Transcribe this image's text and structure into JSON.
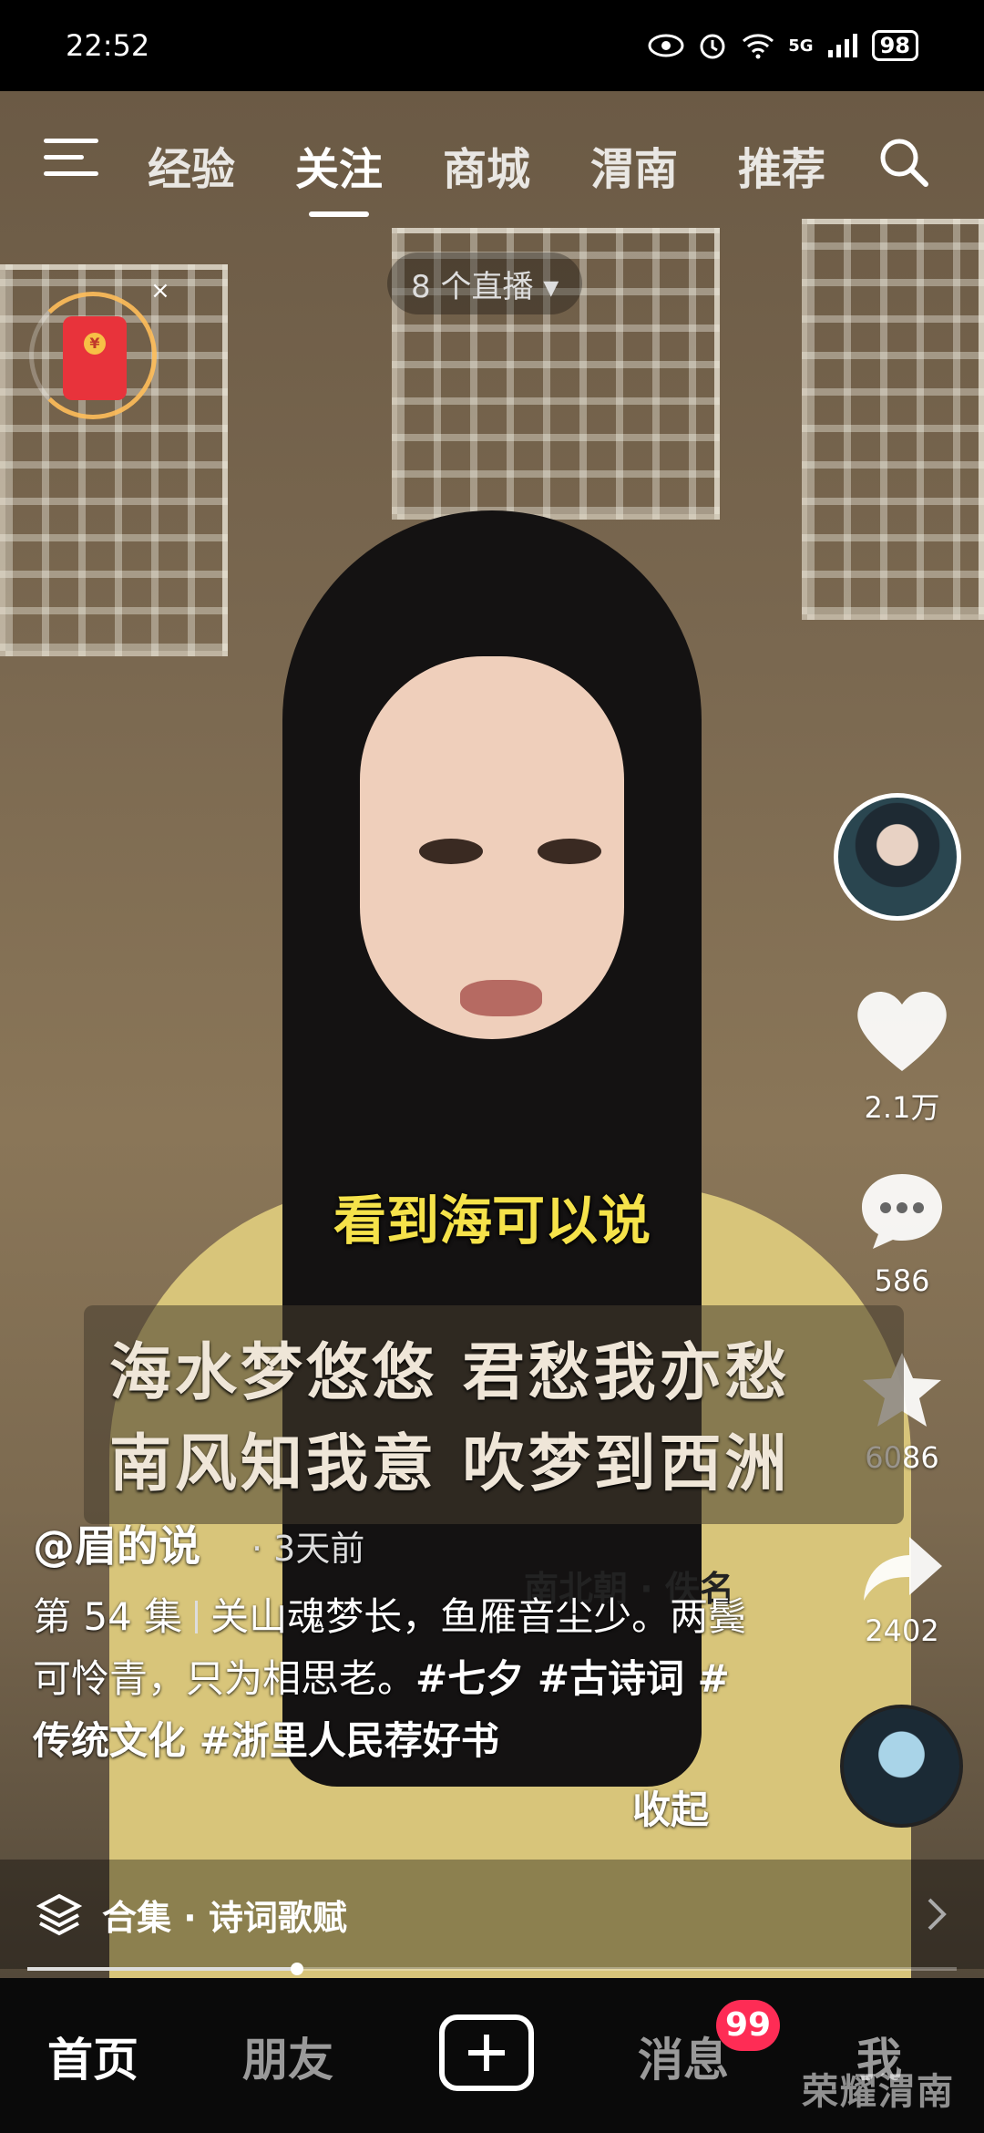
{
  "status_bar": {
    "time": "22:52",
    "network": "5G",
    "battery": "98"
  },
  "top_nav": {
    "tabs": [
      {
        "label": "经验",
        "active": false
      },
      {
        "label": "关注",
        "active": true
      },
      {
        "label": "商城",
        "active": false
      },
      {
        "label": "渭南",
        "active": false
      },
      {
        "label": "推荐",
        "active": false
      }
    ]
  },
  "live_pill": "8 个直播 ▾",
  "video": {
    "subtitle": "看到海可以说",
    "poem_lines": [
      "海水梦悠悠 君愁我亦愁",
      "南风知我意 吹梦到西洲"
    ],
    "poem_attribution": "南北朝 · 佚名"
  },
  "side_actions": {
    "likes": "2.1万",
    "comments": "586",
    "favorites": "6086",
    "shares": "2402"
  },
  "post": {
    "author": "@眉的说",
    "time": "· 3天前",
    "episode": "第 54 集",
    "text": "关山魂梦长，鱼雁音尘少。两鬓可怜青，只为相思老。",
    "hashtags": "#七夕 #古诗词 #传统文化 #浙里人民荐好书",
    "collapse": "收起"
  },
  "collection": {
    "label": "合集 · 诗词歌赋"
  },
  "playback": {
    "progress": 0.29
  },
  "bottom_nav": {
    "home": "首页",
    "friends": "朋友",
    "messages": "消息",
    "messages_badge": "99",
    "me": "我"
  },
  "watermark": "荣耀渭南"
}
